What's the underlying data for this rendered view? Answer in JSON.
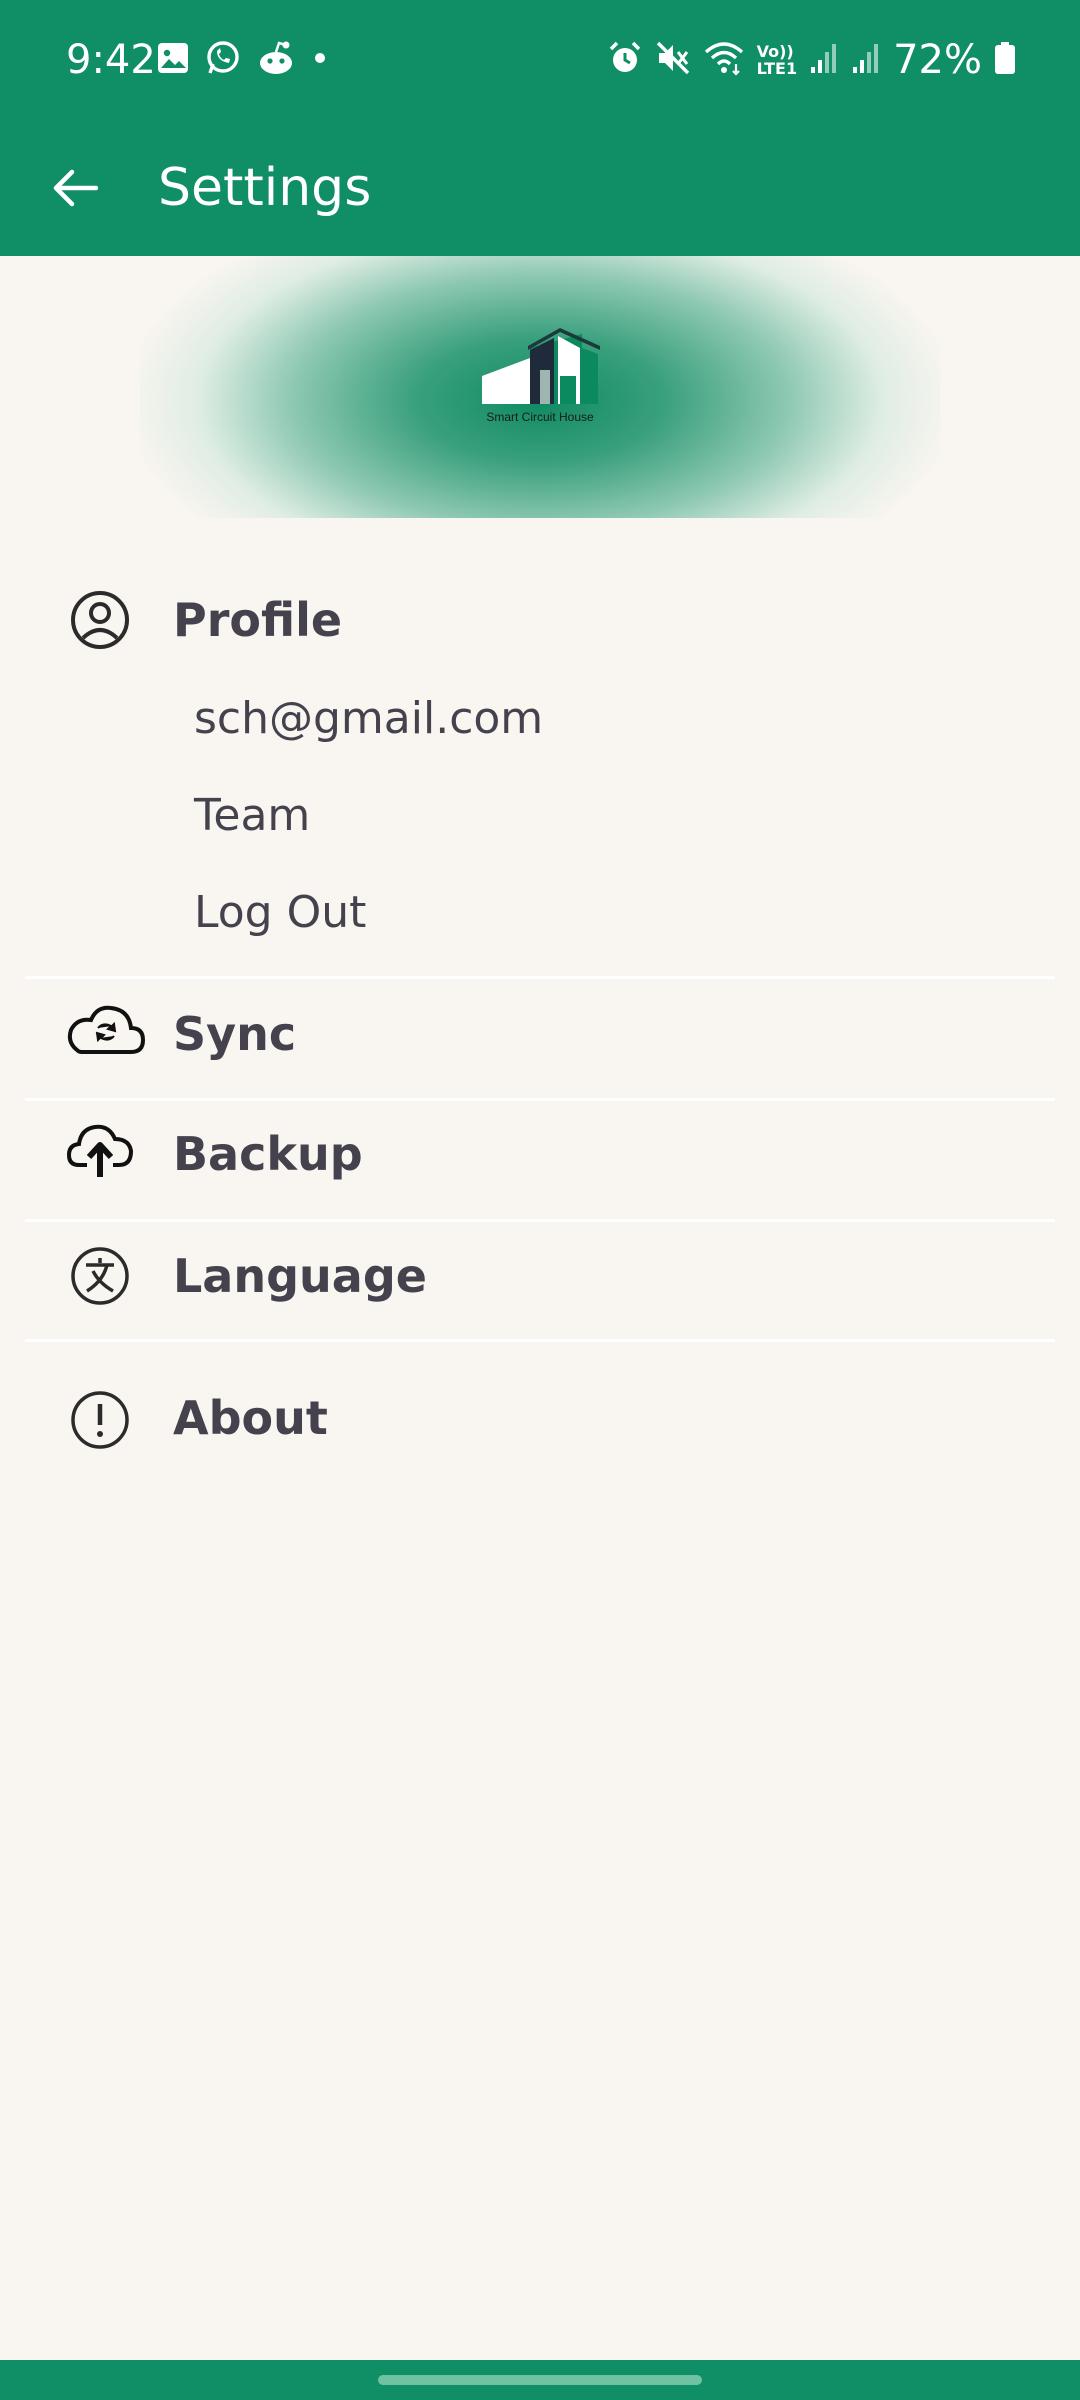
{
  "status_bar": {
    "time": "9:42",
    "battery": "72%",
    "left_icons": [
      "gallery-icon",
      "whatsapp-icon",
      "reddit-icon",
      "dot-icon"
    ],
    "right_icons": [
      "alarm-icon",
      "mute-icon",
      "wifi-icon",
      "volte-icon",
      "signal-icon",
      "signal-icon",
      "battery-icon"
    ],
    "volte_text": "Vo))",
    "lte_text": "LTE1"
  },
  "app_bar": {
    "title": "Settings",
    "back_icon": "back-arrow-icon"
  },
  "banner": {
    "logo_caption": "Smart Circuit House"
  },
  "menu": {
    "profile": {
      "label": "Profile",
      "icon": "user-circle-icon",
      "items": [
        "sch@gmail.com",
        "Team",
        "Log Out"
      ]
    },
    "sync": {
      "label": "Sync",
      "icon": "cloud-sync-icon"
    },
    "backup": {
      "label": "Backup",
      "icon": "cloud-upload-icon"
    },
    "language": {
      "label": "Language",
      "icon": "language-icon"
    },
    "about": {
      "label": "About",
      "icon": "info-circle-icon"
    }
  },
  "colors": {
    "primary": "#108e66",
    "background": "#f9f5f0",
    "text": "#45424d"
  }
}
